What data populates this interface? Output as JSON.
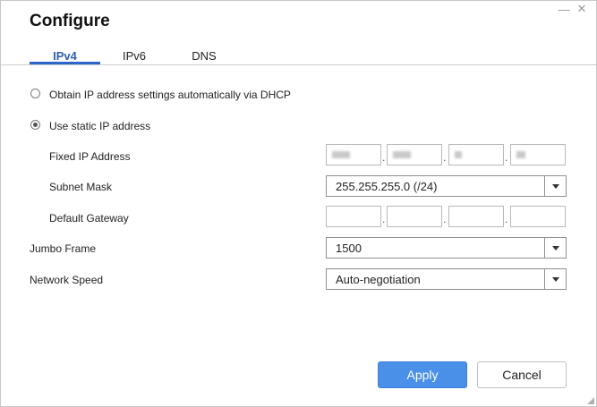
{
  "window": {
    "title": "Configure",
    "minimize_glyph": "—",
    "close_glyph": "✕"
  },
  "tabs": [
    {
      "label": "IPv4",
      "active": true
    },
    {
      "label": "IPv6",
      "active": false
    },
    {
      "label": "DNS",
      "active": false
    }
  ],
  "ip_mode": {
    "dhcp_label": "Obtain IP address settings automatically via DHCP",
    "static_label": "Use static IP address",
    "selected": "static"
  },
  "static": {
    "fixed_ip_label": "Fixed IP Address",
    "subnet_label": "Subnet Mask",
    "subnet_value": "255.255.255.0 (/24)",
    "gateway_label": "Default Gateway",
    "gateway_octets": [
      "",
      "",
      "",
      ""
    ]
  },
  "jumbo_frame": {
    "label": "Jumbo Frame",
    "value": "1500"
  },
  "network_speed": {
    "label": "Network Speed",
    "value": "Auto-negotiation"
  },
  "buttons": {
    "apply": "Apply",
    "cancel": "Cancel"
  }
}
